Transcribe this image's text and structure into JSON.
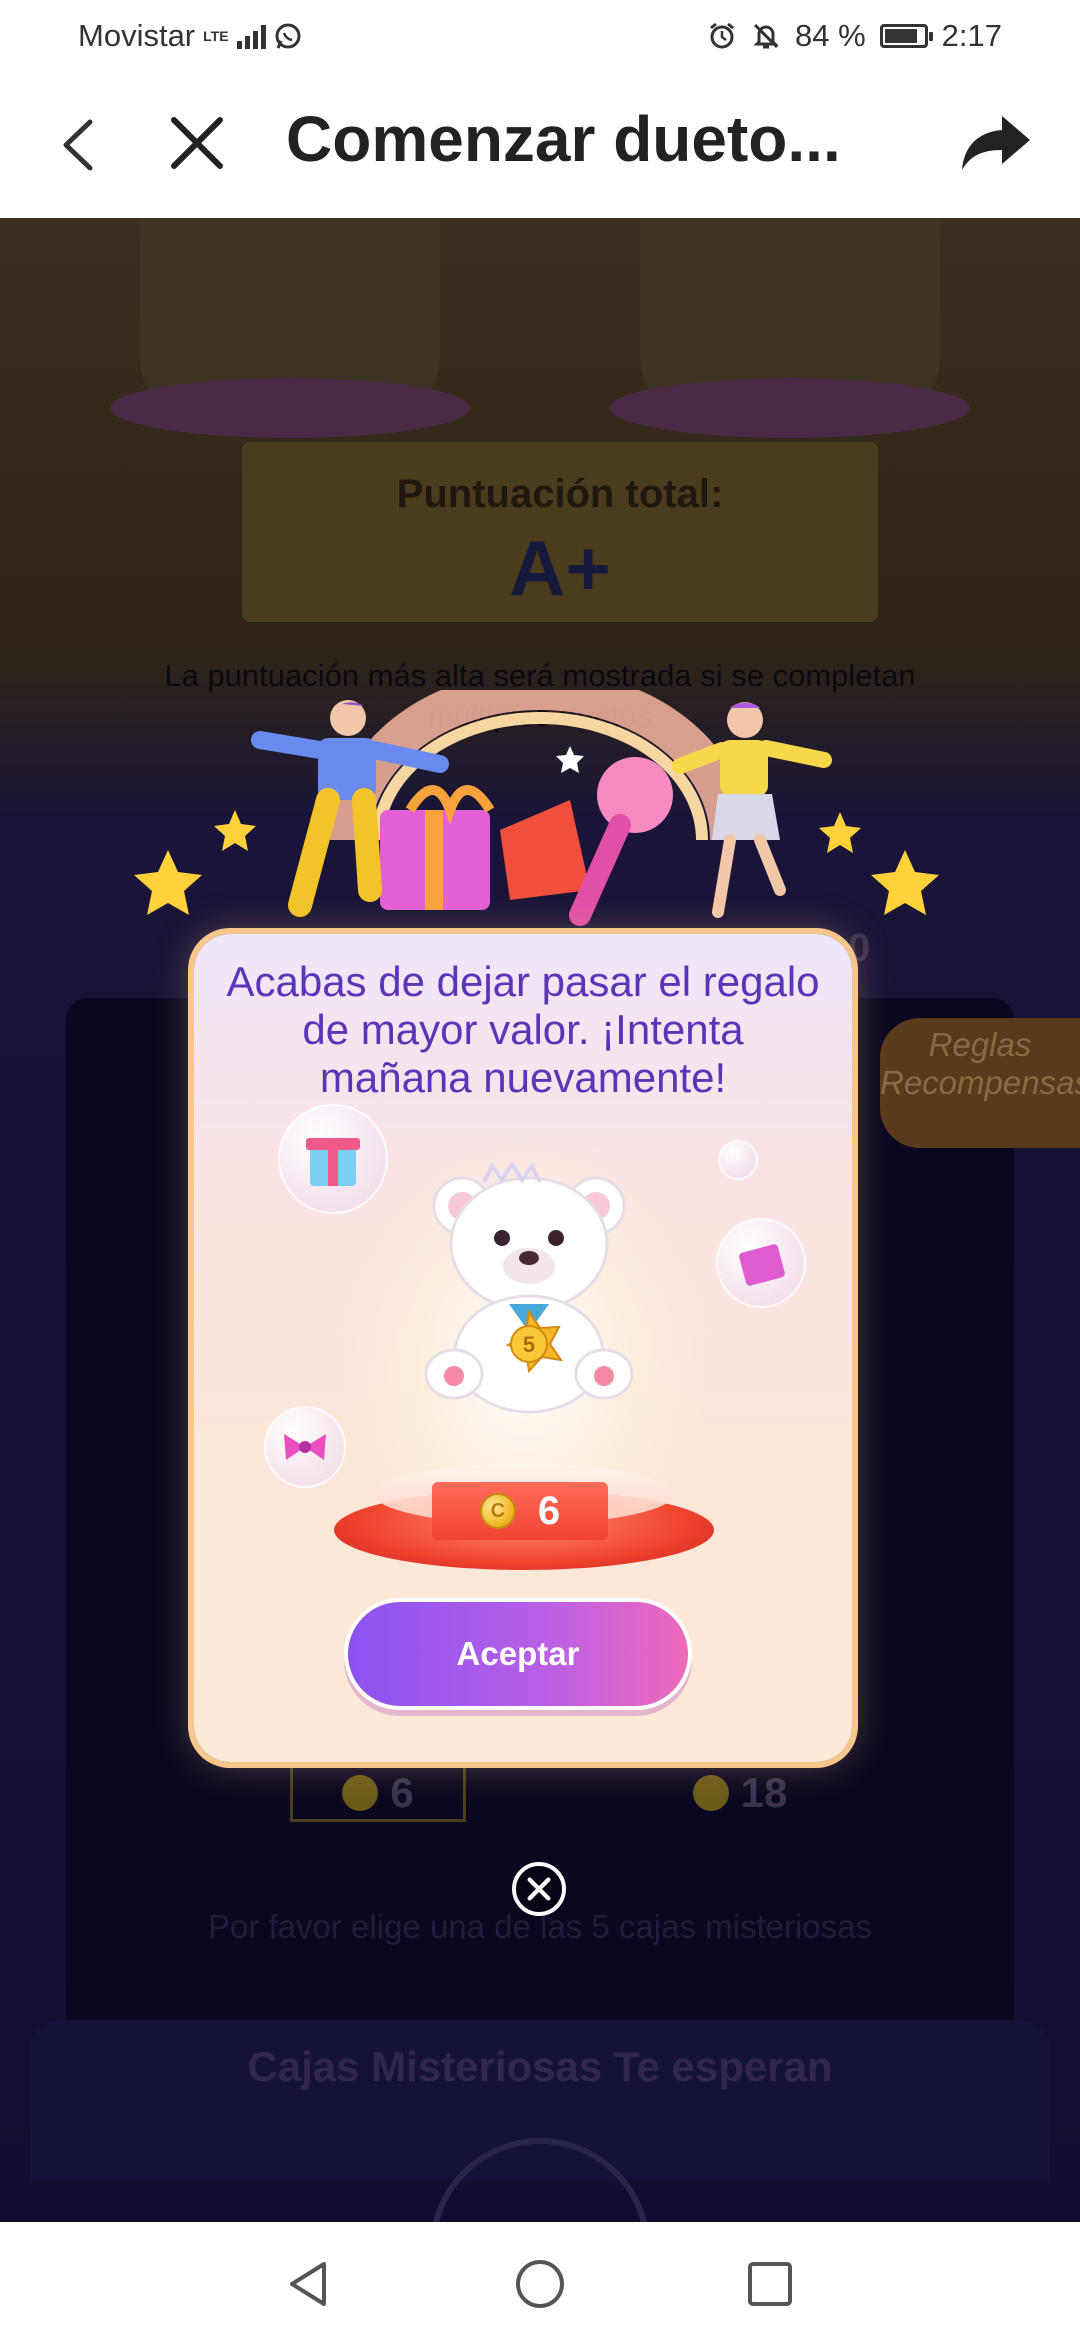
{
  "status_bar": {
    "carrier": "Movistar",
    "network": "LTE",
    "battery": "84 %",
    "battery_level": 0.84,
    "time": "2:17"
  },
  "app_bar": {
    "title": "Comenzar dueto..."
  },
  "background": {
    "score_label": "Puntuación total:",
    "score_grade": "A+",
    "score_note": "La puntuación más alta será mostrada si se completan múltiples duetos",
    "rules_label": "Reglas Recompensas",
    "price_left": "6",
    "price_right": "18",
    "side_value": "0",
    "hint": "Por favor elige una de las 5 cajas misteriosas",
    "banner": "Cajas Misteriosas Te esperan"
  },
  "modal": {
    "message": "Acabas de dejar pasar el regalo de mayor valor. ¡Intenta mañana nuevamente!",
    "badge_label": "5",
    "price": "6",
    "accept_label": "Aceptar"
  },
  "colors": {
    "accent_purple": "#8b52f0",
    "accent_pink": "#ef6aba",
    "message_text": "#5b34b8"
  }
}
